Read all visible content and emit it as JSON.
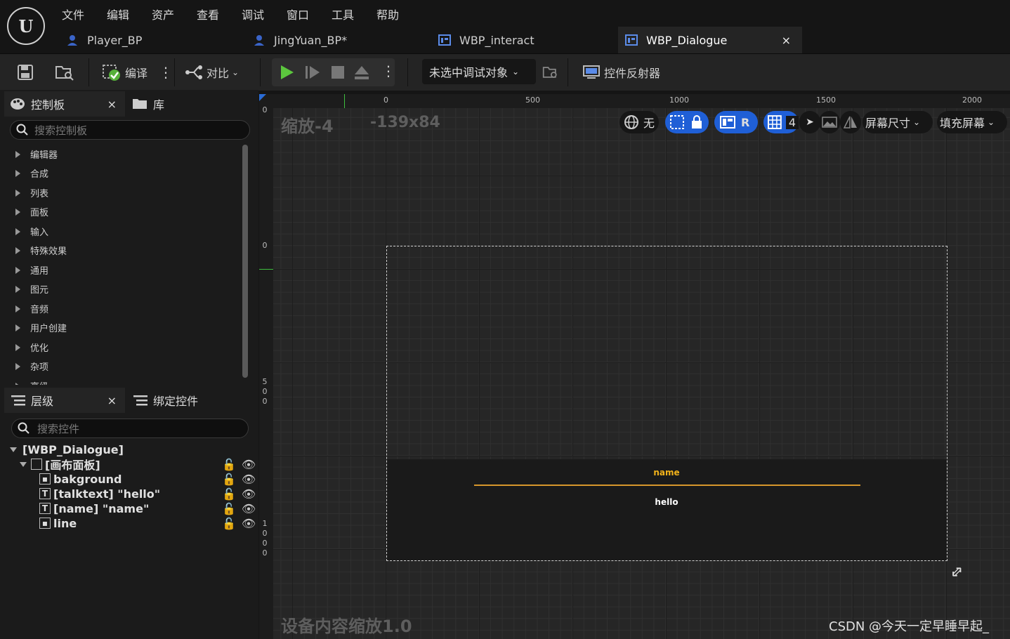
{
  "menu": [
    "文件",
    "编辑",
    "资产",
    "查看",
    "调试",
    "窗口",
    "工具",
    "帮助"
  ],
  "tabs": [
    {
      "label": "Player_BP",
      "icon": "user-blueprint-icon"
    },
    {
      "label": "JingYuan_BP*",
      "icon": "user-blueprint-icon"
    },
    {
      "label": "WBP_interact",
      "icon": "widget-blueprint-icon"
    },
    {
      "label": "WBP_Dialogue",
      "icon": "widget-blueprint-icon",
      "active": true,
      "close": "×"
    }
  ],
  "toolbar": {
    "compile_label": "编译",
    "diff_label": "对比",
    "debug_target": "未选中调试对象",
    "reflector_label": "控件反射器"
  },
  "palette": {
    "tab_label": "控制板",
    "close": "×",
    "library_label": "库",
    "search_placeholder": "搜索控制板",
    "categories": [
      "编辑器",
      "合成",
      "列表",
      "面板",
      "输入",
      "特殊效果",
      "通用",
      "图元",
      "音频",
      "用户创建",
      "优化",
      "杂项",
      "高级"
    ]
  },
  "hierarchy": {
    "tab_label": "层级",
    "close": "×",
    "bind_label": "绑定控件",
    "search_placeholder": "搜索控件",
    "root": "[WBP_Dialogue]",
    "canvas": "[画布面板]",
    "children": [
      {
        "label": "bakground",
        "icon": "image-widget-icon"
      },
      {
        "label": "[talktext] \"hello\"",
        "icon": "text-widget-icon"
      },
      {
        "label": "[name] \"name\"",
        "icon": "text-widget-icon"
      },
      {
        "label": "line",
        "icon": "image-widget-icon"
      }
    ]
  },
  "designer": {
    "zoom": "缩放-4",
    "resolution": "-139x84",
    "dpi_scale": "设备内容缩放1.0",
    "ruler_top": [
      "0",
      "500",
      "1000",
      "1500",
      "2000"
    ],
    "ruler_left": [
      "0",
      "0",
      "500",
      "1000"
    ],
    "toolbar": {
      "none_label": "无",
      "r_label": "R",
      "grid_value": "4",
      "screen_size": "屏幕尺寸",
      "fill_screen": "填充屏幕"
    },
    "widget": {
      "name_text": "name",
      "hello_text": "hello",
      "name_color": "#f2b21a",
      "line_color": "#d6962c"
    }
  },
  "watermark": "CSDN @今天一定早睡早起_"
}
